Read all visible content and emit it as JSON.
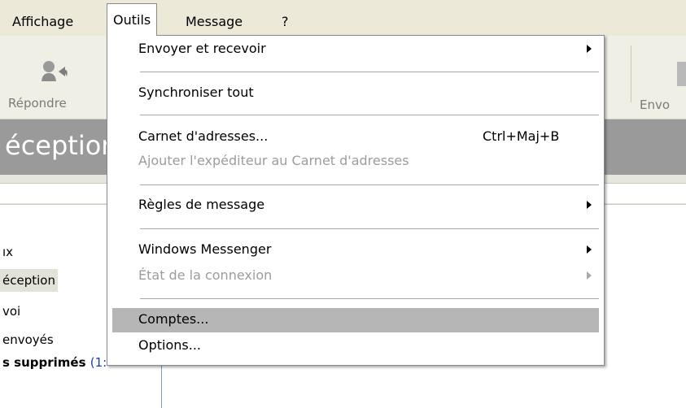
{
  "menubar": {
    "items": [
      {
        "label": "Affichage"
      },
      {
        "label": "Outils"
      },
      {
        "label": "Message"
      },
      {
        "label": "?"
      }
    ]
  },
  "toolbar": {
    "reply_label": "Répondre",
    "reply_icon": "reply-icon",
    "send_label_partial": "Envo"
  },
  "folder_header": {
    "title_partial": "éceptior"
  },
  "folders": [
    {
      "label": "ıx"
    },
    {
      "label": "éception"
    },
    {
      "label": "voi"
    },
    {
      "label": "envoyés"
    },
    {
      "label": "s supprimés",
      "count": "(1:"
    }
  ],
  "outils_menu": {
    "items": [
      {
        "label": "Envoyer et recevoir",
        "submenu": true
      },
      {
        "label": "Synchroniser tout"
      },
      {
        "label": "Carnet d'adresses...",
        "shortcut": "Ctrl+Maj+B"
      },
      {
        "label": "Ajouter l'expéditeur au Carnet d'adresses",
        "disabled": true
      },
      {
        "label": "Règles de message",
        "submenu": true
      },
      {
        "label": "Windows Messenger",
        "submenu": true
      },
      {
        "label": "État de la connexion",
        "submenu": true,
        "disabled": true
      },
      {
        "label": "Comptes...",
        "highlighted": true
      },
      {
        "label": "Options..."
      }
    ]
  },
  "colors": {
    "menubar_bg": "#ece9d8",
    "folderbar_bg": "#9a9a9a",
    "highlight_bg": "#b6b6b6",
    "disabled_text": "#9c9c9c",
    "link_count": "#1a3fa8"
  }
}
